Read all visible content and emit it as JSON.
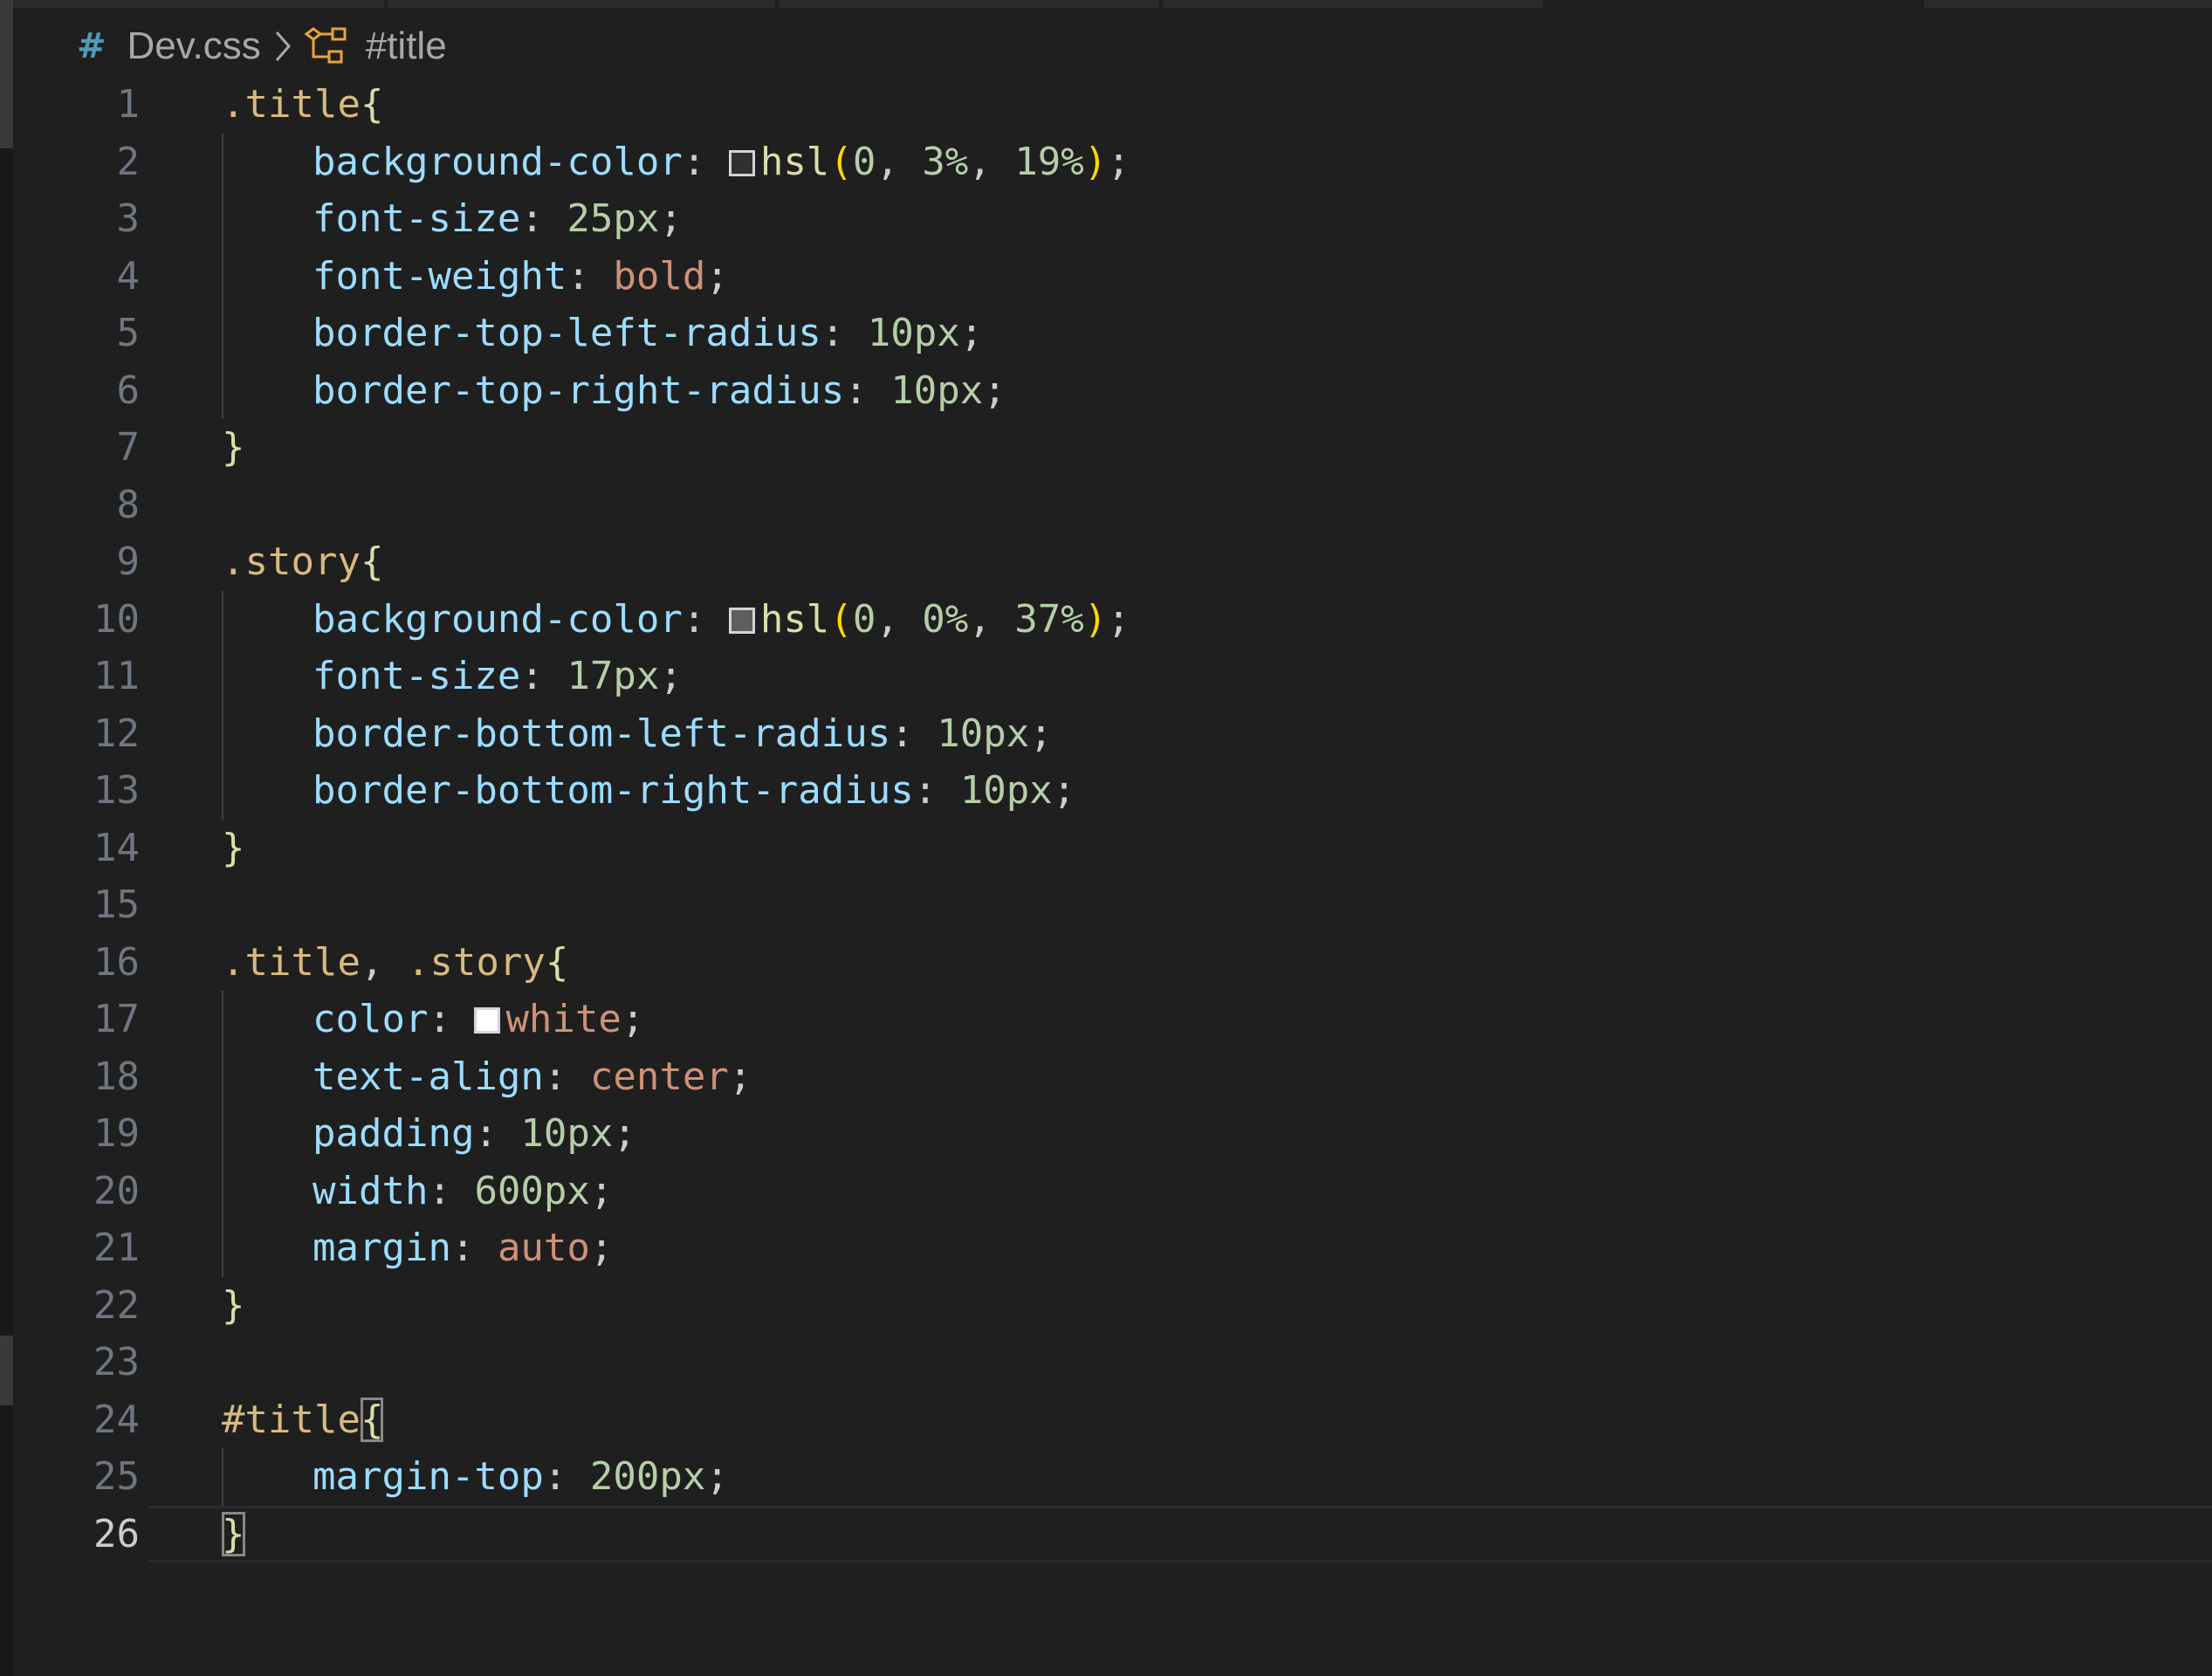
{
  "breadcrumb": {
    "file": "Dev.css",
    "symbol": "#title"
  },
  "colors": {
    "editor_bg": "#1f1f1f",
    "selector": "#d7ba7d",
    "property": "#9cdcfe",
    "number": "#b5cea8",
    "keyword_value": "#ce9178",
    "function": "#dcdcaa",
    "paren": "#ffd700",
    "line_number": "#6e7681"
  },
  "code": [
    {
      "n": "1",
      "tokens": [
        {
          "t": ".title",
          "c": "sel"
        },
        {
          "t": "{",
          "c": "brk"
        }
      ]
    },
    {
      "n": "2",
      "tokens": [
        {
          "t": "background-color",
          "c": "prop"
        },
        {
          "t": ": ",
          "c": "p"
        },
        {
          "swatch": "#313030"
        },
        {
          "t": "hsl",
          "c": "fn"
        },
        {
          "t": "(",
          "c": "par"
        },
        {
          "t": "0",
          "c": "num"
        },
        {
          "t": ", ",
          "c": "p"
        },
        {
          "t": "3%",
          "c": "num"
        },
        {
          "t": ", ",
          "c": "p"
        },
        {
          "t": "19%",
          "c": "num"
        },
        {
          "t": ")",
          "c": "par"
        },
        {
          "t": ";",
          "c": "p"
        }
      ]
    },
    {
      "n": "3",
      "tokens": [
        {
          "t": "font-size",
          "c": "prop"
        },
        {
          "t": ": ",
          "c": "p"
        },
        {
          "t": "25px",
          "c": "num"
        },
        {
          "t": ";",
          "c": "p"
        }
      ]
    },
    {
      "n": "4",
      "tokens": [
        {
          "t": "font-weight",
          "c": "prop"
        },
        {
          "t": ": ",
          "c": "p"
        },
        {
          "t": "bold",
          "c": "kw"
        },
        {
          "t": ";",
          "c": "p"
        }
      ]
    },
    {
      "n": "5",
      "tokens": [
        {
          "t": "border-top-left-radius",
          "c": "prop"
        },
        {
          "t": ": ",
          "c": "p"
        },
        {
          "t": "10px",
          "c": "num"
        },
        {
          "t": ";",
          "c": "p"
        }
      ]
    },
    {
      "n": "6",
      "tokens": [
        {
          "t": "border-top-right-radius",
          "c": "prop"
        },
        {
          "t": ": ",
          "c": "p"
        },
        {
          "t": "10px",
          "c": "num"
        },
        {
          "t": ";",
          "c": "p"
        }
      ]
    },
    {
      "n": "7",
      "tokens": [
        {
          "t": "}",
          "c": "brk"
        }
      ]
    },
    {
      "n": "8",
      "tokens": []
    },
    {
      "n": "9",
      "tokens": [
        {
          "t": ".story",
          "c": "sel"
        },
        {
          "t": "{",
          "c": "brk"
        }
      ]
    },
    {
      "n": "10",
      "tokens": [
        {
          "t": "background-color",
          "c": "prop"
        },
        {
          "t": ": ",
          "c": "p"
        },
        {
          "swatch": "#5e5e5e"
        },
        {
          "t": "hsl",
          "c": "fn"
        },
        {
          "t": "(",
          "c": "par"
        },
        {
          "t": "0",
          "c": "num"
        },
        {
          "t": ", ",
          "c": "p"
        },
        {
          "t": "0%",
          "c": "num"
        },
        {
          "t": ", ",
          "c": "p"
        },
        {
          "t": "37%",
          "c": "num"
        },
        {
          "t": ")",
          "c": "par"
        },
        {
          "t": ";",
          "c": "p"
        }
      ]
    },
    {
      "n": "11",
      "tokens": [
        {
          "t": "font-size",
          "c": "prop"
        },
        {
          "t": ": ",
          "c": "p"
        },
        {
          "t": "17px",
          "c": "num"
        },
        {
          "t": ";",
          "c": "p"
        }
      ]
    },
    {
      "n": "12",
      "tokens": [
        {
          "t": "border-bottom-left-radius",
          "c": "prop"
        },
        {
          "t": ": ",
          "c": "p"
        },
        {
          "t": "10px",
          "c": "num"
        },
        {
          "t": ";",
          "c": "p"
        }
      ]
    },
    {
      "n": "13",
      "tokens": [
        {
          "t": "border-bottom-right-radius",
          "c": "prop"
        },
        {
          "t": ": ",
          "c": "p"
        },
        {
          "t": "10px",
          "c": "num"
        },
        {
          "t": ";",
          "c": "p"
        }
      ]
    },
    {
      "n": "14",
      "tokens": [
        {
          "t": "}",
          "c": "brk"
        }
      ]
    },
    {
      "n": "15",
      "tokens": []
    },
    {
      "n": "16",
      "tokens": [
        {
          "t": ".title",
          "c": "sel"
        },
        {
          "t": ", ",
          "c": "p"
        },
        {
          "t": ".story",
          "c": "sel"
        },
        {
          "t": "{",
          "c": "brk"
        }
      ]
    },
    {
      "n": "17",
      "tokens": [
        {
          "t": "color",
          "c": "prop"
        },
        {
          "t": ": ",
          "c": "p"
        },
        {
          "swatch": "#ffffff"
        },
        {
          "t": "white",
          "c": "kw"
        },
        {
          "t": ";",
          "c": "p"
        }
      ]
    },
    {
      "n": "18",
      "tokens": [
        {
          "t": "text-align",
          "c": "prop"
        },
        {
          "t": ": ",
          "c": "p"
        },
        {
          "t": "center",
          "c": "kw"
        },
        {
          "t": ";",
          "c": "p"
        }
      ]
    },
    {
      "n": "19",
      "tokens": [
        {
          "t": "padding",
          "c": "prop"
        },
        {
          "t": ": ",
          "c": "p"
        },
        {
          "t": "10px",
          "c": "num"
        },
        {
          "t": ";",
          "c": "p"
        }
      ]
    },
    {
      "n": "20",
      "tokens": [
        {
          "t": "width",
          "c": "prop"
        },
        {
          "t": ": ",
          "c": "p"
        },
        {
          "t": "600px",
          "c": "num"
        },
        {
          "t": ";",
          "c": "p"
        }
      ]
    },
    {
      "n": "21",
      "tokens": [
        {
          "t": "margin",
          "c": "prop"
        },
        {
          "t": ": ",
          "c": "p"
        },
        {
          "t": "auto",
          "c": "kw"
        },
        {
          "t": ";",
          "c": "p"
        }
      ]
    },
    {
      "n": "22",
      "tokens": [
        {
          "t": "}",
          "c": "brk"
        }
      ]
    },
    {
      "n": "23",
      "tokens": []
    },
    {
      "n": "24",
      "tokens": [
        {
          "t": "#title",
          "c": "sel"
        },
        {
          "t": "{",
          "c": "brk",
          "match": true
        }
      ]
    },
    {
      "n": "25",
      "tokens": [
        {
          "t": "margin-top",
          "c": "prop"
        },
        {
          "t": ": ",
          "c": "p"
        },
        {
          "t": "200px",
          "c": "num"
        },
        {
          "t": ";",
          "c": "p"
        }
      ]
    },
    {
      "n": "26",
      "tokens": [
        {
          "t": "}",
          "c": "brk",
          "match": true
        }
      ],
      "current": true
    }
  ]
}
